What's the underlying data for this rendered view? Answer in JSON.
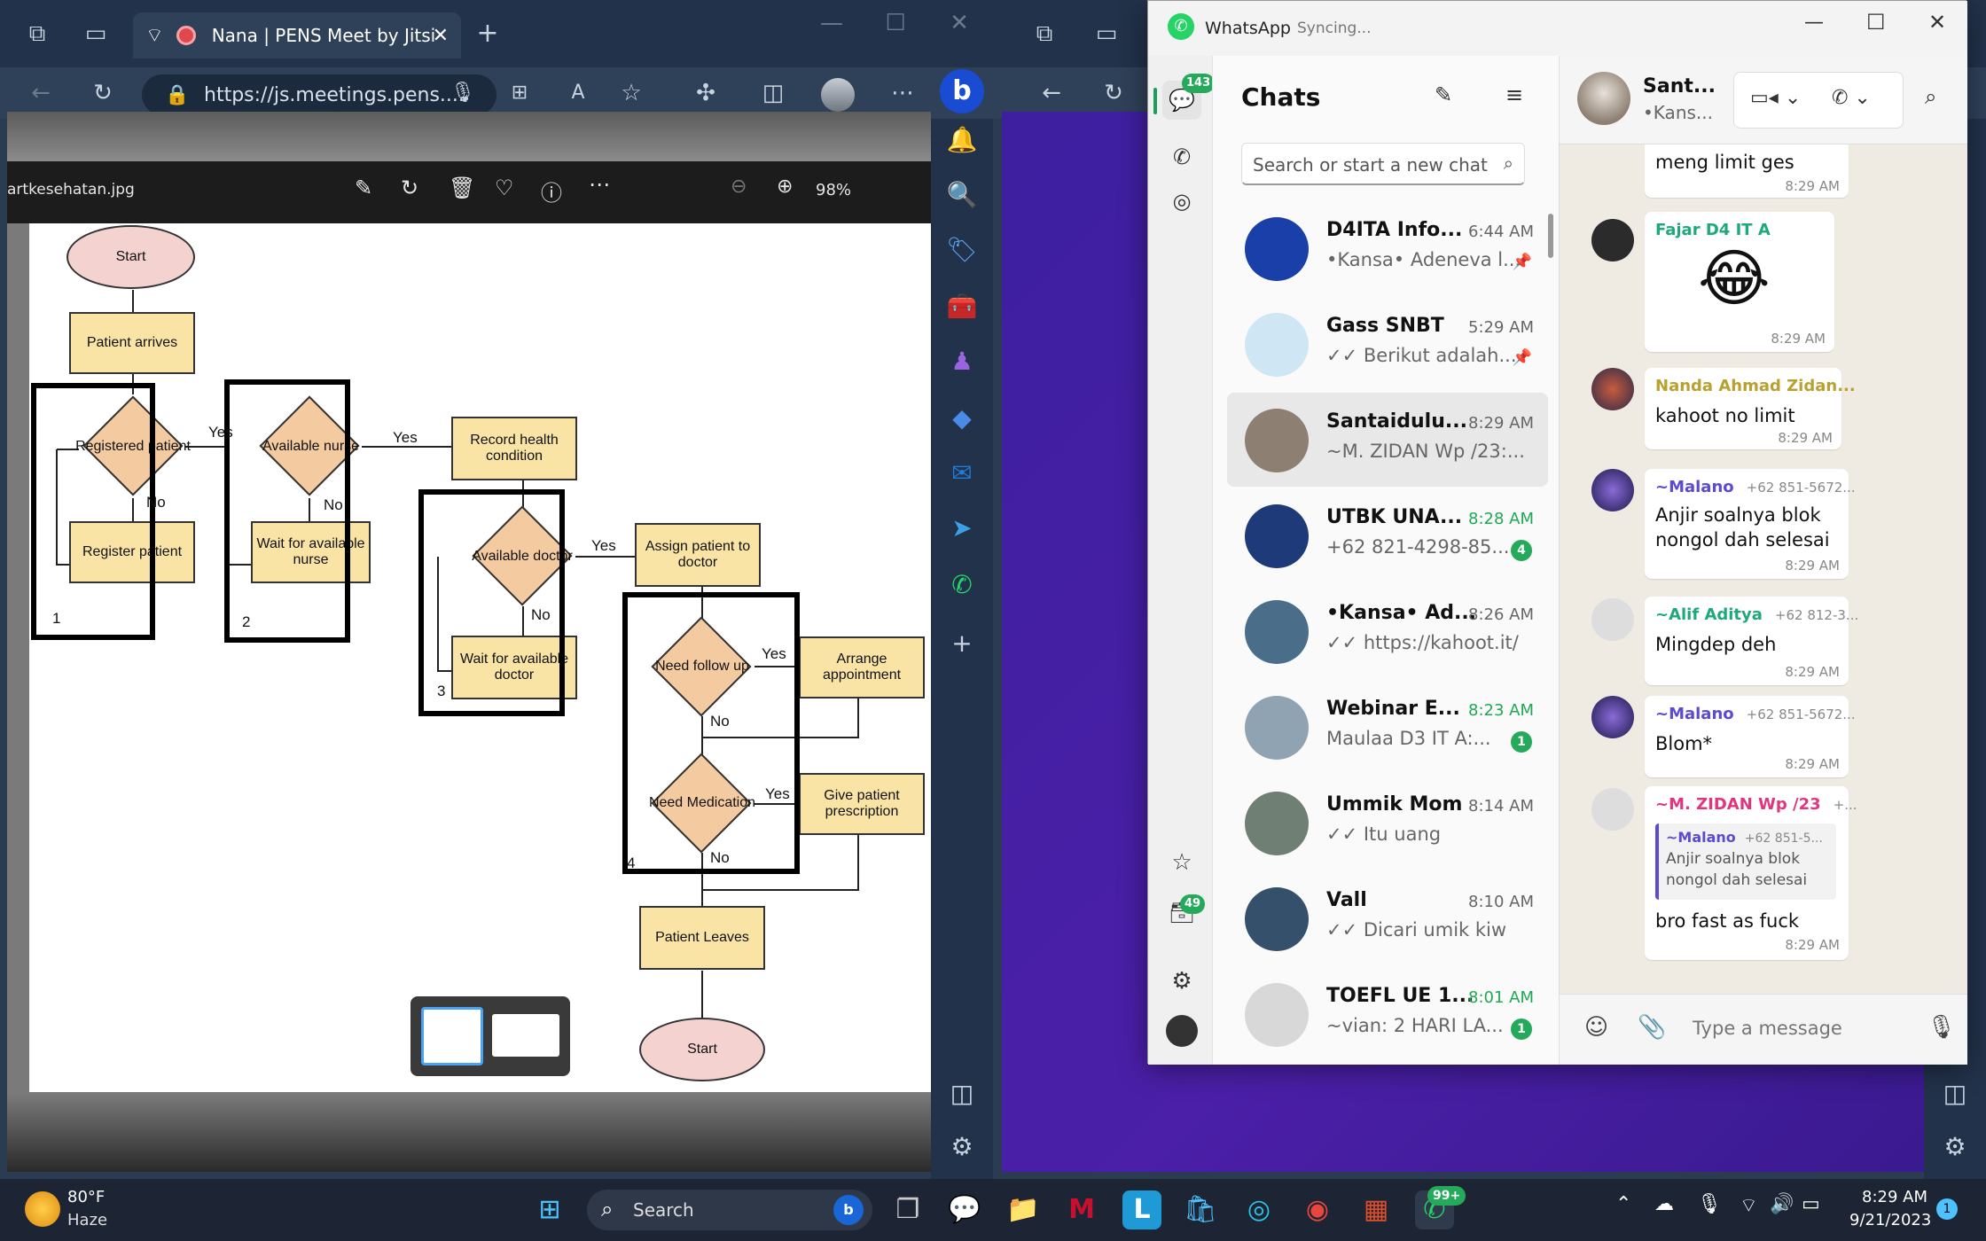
{
  "edge_left": {
    "tab_title": "Nana | PENS Meet by Jitsi",
    "url": "https://js.meetings.pens....",
    "new_tab": "+"
  },
  "viewer": {
    "filename": "artkesehatan.jpg",
    "zoom": "98%"
  },
  "flowchart": {
    "start": "Start",
    "patient_arrives": "Patient arrives",
    "registered": "Registered patient",
    "register": "Register patient",
    "available_nurse": "Available nurse",
    "wait_nurse": "Wait for available nurse",
    "record_health": "Record health condition",
    "available_doctor": "Available doctor",
    "wait_doctor": "Wait for available doctor",
    "assign": "Assign patient to doctor",
    "need_follow": "Need follow up",
    "arrange": "Arrange appointment",
    "need_med": "Need Medication",
    "give_presc": "Give patient prescription",
    "leaves": "Patient Leaves",
    "end": "Start",
    "yes": "Yes",
    "yes_short": "Yes",
    "no": "No",
    "n1": "1",
    "n2": "2",
    "n3": "3",
    "n4": "4"
  },
  "whatsapp": {
    "title": "WhatsApp",
    "status": "Syncing...",
    "chats_heading": "Chats",
    "search_placeholder": "Search or start a new chat",
    "rail_badge_chats": "143",
    "rail_badge_archive": "49",
    "chats": [
      {
        "name": "D4ITA Info...",
        "time": "6:44 AM",
        "msg": "•Kansa• Adeneva l...",
        "badge": "",
        "pinned": true,
        "avatar": "#1b3fa8"
      },
      {
        "name": "Gass SNBT",
        "time": "5:29 AM",
        "msg": "✓✓ Berikut adalah...",
        "badge": "",
        "pinned": true,
        "avatar": "#cfe6f4"
      },
      {
        "name": "Santaidulu...",
        "time": "8:29 AM",
        "msg": "~M. ZIDAN Wp /23:...",
        "badge": "",
        "pinned": false,
        "avatar": "#8d7f72"
      },
      {
        "name": "UTBK UNA...",
        "time": "8:28 AM",
        "msg": "+62 821-4298-85...",
        "badge": "4",
        "pinned": false,
        "avatar": "#1e3a78"
      },
      {
        "name": "•Kansa• Ad...",
        "time": "8:26 AM",
        "msg": "✓✓ https://kahoot.it/",
        "badge": "",
        "pinned": false,
        "avatar": "#4a6d8a"
      },
      {
        "name": "Webinar E...",
        "time": "8:23 AM",
        "msg": "Maulaa D3 IT A:...",
        "badge": "1",
        "pinned": false,
        "avatar": "#8fa3b3"
      },
      {
        "name": "Ummik Mom",
        "time": "8:14 AM",
        "msg": "✓✓ Itu uang",
        "badge": "",
        "pinned": false,
        "avatar": "#6f7f73"
      },
      {
        "name": "Vall",
        "time": "8:10 AM",
        "msg": "✓✓ Dicari umik kiw",
        "badge": "",
        "pinned": false,
        "avatar": "#34506b"
      },
      {
        "name": "TOEFL UE 1...",
        "time": "8:01 AM",
        "msg": "~vian: 2 HARI LA...",
        "badge": "1",
        "pinned": false,
        "avatar": "#d8d8d8"
      }
    ],
    "header_name": "Sant...",
    "header_sub": "•Kans...",
    "messages": [
      {
        "name": "",
        "phone": "",
        "text": "meng limit ges",
        "time": "8:29 AM",
        "color": "#000"
      },
      {
        "name": "Fajar D4 IT A",
        "phone": "",
        "text": "😂",
        "time": "8:29 AM",
        "color": "#1ea97c"
      },
      {
        "name": "Nanda Ahmad Zidan...",
        "phone": "",
        "text": "kahoot no limit",
        "time": "8:29 AM",
        "color": "#b8a12f"
      },
      {
        "name": "~Malano",
        "phone": "+62 851-5672...",
        "text": "Anjir soalnya blok",
        "text2": "nongol dah selesai",
        "time": "8:29 AM",
        "color": "#5b4bd0"
      },
      {
        "name": "~Alif Aditya",
        "phone": "+62 812-3...",
        "text": "Mingdep deh",
        "time": "8:29 AM",
        "color": "#1ea97c"
      },
      {
        "name": "~Malano",
        "phone": "+62 851-5672...",
        "text": "Blom*",
        "time": "8:29 AM",
        "color": "#5b4bd0"
      },
      {
        "name": "~M. ZIDAN Wp /23",
        "phone": "+...",
        "text": "bro fast as fuck",
        "time": "8:29 AM",
        "color": "#e0357f"
      }
    ],
    "quote": {
      "name": "~Malano",
      "phone": "+62 851-5...",
      "line1": "Anjir soalnya blok",
      "line2": "nongol dah selesai"
    },
    "input_placeholder": "Type a message"
  },
  "taskbar": {
    "weather_temp": "80°F",
    "weather_desc": "Haze",
    "search": "Search",
    "wa_badge": "99+",
    "time": "8:29 AM",
    "date": "9/21/2023",
    "notif": "1"
  }
}
